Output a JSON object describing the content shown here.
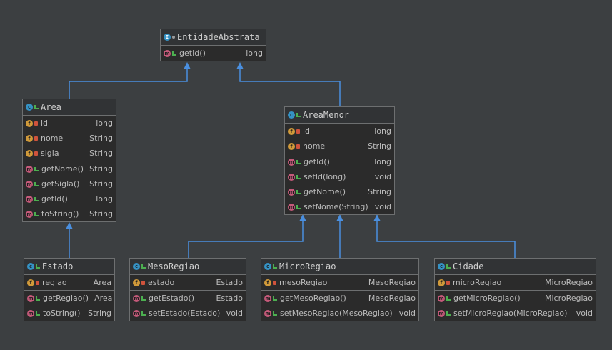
{
  "classes": {
    "entidade": {
      "name": "EntidadeAbstrata",
      "methods": [
        {
          "name": "getId()",
          "type": "long"
        }
      ]
    },
    "area": {
      "name": "Area",
      "fields": [
        {
          "name": "id",
          "type": "long"
        },
        {
          "name": "nome",
          "type": "String"
        },
        {
          "name": "sigla",
          "type": "String"
        }
      ],
      "methods": [
        {
          "name": "getNome()",
          "type": "String"
        },
        {
          "name": "getSigla()",
          "type": "String"
        },
        {
          "name": "getId()",
          "type": "long"
        },
        {
          "name": "toString()",
          "type": "String"
        }
      ]
    },
    "areamenor": {
      "name": "AreaMenor",
      "fields": [
        {
          "name": "id",
          "type": "long"
        },
        {
          "name": "nome",
          "type": "String"
        }
      ],
      "methods": [
        {
          "name": "getId()",
          "type": "long"
        },
        {
          "name": "setId(long)",
          "type": "void"
        },
        {
          "name": "getNome()",
          "type": "String"
        },
        {
          "name": "setNome(String)",
          "type": "void"
        }
      ]
    },
    "estado": {
      "name": "Estado",
      "fields": [
        {
          "name": "regiao",
          "type": "Area"
        }
      ],
      "methods": [
        {
          "name": "getRegiao()",
          "type": "Area"
        },
        {
          "name": "toString()",
          "type": "String"
        }
      ]
    },
    "mesoregiao": {
      "name": "MesoRegiao",
      "fields": [
        {
          "name": "estado",
          "type": "Estado"
        }
      ],
      "methods": [
        {
          "name": "getEstado()",
          "type": "Estado"
        },
        {
          "name": "setEstado(Estado)",
          "type": "void"
        }
      ]
    },
    "microregiao": {
      "name": "MicroRegiao",
      "fields": [
        {
          "name": "mesoRegiao",
          "type": "MesoRegiao"
        }
      ],
      "methods": [
        {
          "name": "getMesoRegiao()",
          "type": "MesoRegiao"
        },
        {
          "name": "setMesoRegiao(MesoRegiao)",
          "type": "void"
        }
      ]
    },
    "cidade": {
      "name": "Cidade",
      "fields": [
        {
          "name": "microRegiao",
          "type": "MicroRegiao"
        }
      ],
      "methods": [
        {
          "name": "getMicroRegiao()",
          "type": "MicroRegiao"
        },
        {
          "name": "setMicroRegiao(MicroRegiao)",
          "type": "void"
        }
      ]
    }
  },
  "colors": {
    "background": "#3c3f41",
    "box": "#2b2b2b",
    "edge": "#4a8fdf",
    "class_icon": "#3592c4",
    "field_icon": "#d19a3a",
    "method_icon": "#c55a7a"
  },
  "icons": {
    "class": "class-c-icon",
    "interface": "interface-i-icon",
    "field": "field-f-icon",
    "method": "method-m-icon"
  }
}
